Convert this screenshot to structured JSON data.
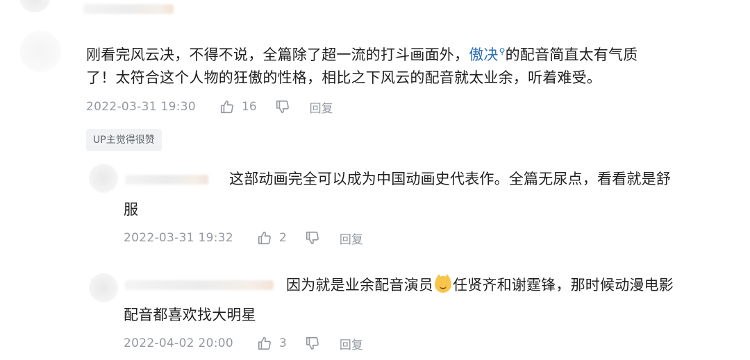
{
  "comments": [
    {
      "line1_before": "刚看完风云决，不得不说，全篇除了超一流的打斗画面外，",
      "highlight": "傲决",
      "line1_after": "的配音简直太有气质",
      "line2": "了！太符合这个人物的狂傲的性格，相比之下风云的配音就太业余，听着难受。",
      "time": "2022-03-31 19:30",
      "likes": "16",
      "reply": "回复",
      "badge": "UP主觉得很赞"
    },
    {
      "line1": "这部动画完全可以成为中国动画史代表作。全篇无尿点，看看就是舒",
      "line2": "服",
      "time": "2022-03-31 19:32",
      "likes": "2",
      "reply": "回复"
    },
    {
      "line1_before": "因为就是业余配音演员",
      "line1_after": "任贤齐和谢霆锋，那时候动漫电影",
      "line2": "配音都喜欢找大明星",
      "time": "2022-04-02 20:00",
      "likes": "3",
      "reply": "回复"
    }
  ],
  "icons": {
    "like": "thumbs-up-icon",
    "dislike": "thumbs-down-icon",
    "search": "search-icon",
    "emoji": "cat-face-emoji"
  },
  "colors": {
    "link": "#2d6fb8",
    "meta": "#9499a0",
    "badge_bg": "#f1f2f3"
  }
}
